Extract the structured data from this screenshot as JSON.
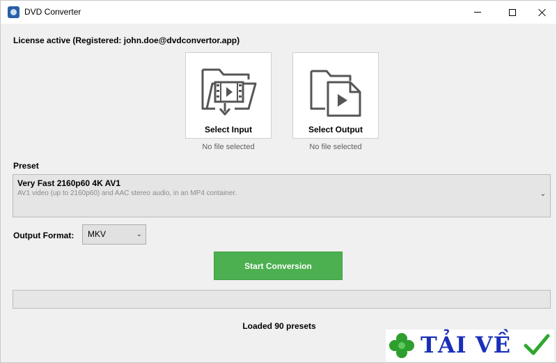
{
  "window": {
    "title": "DVD Converter"
  },
  "license": {
    "text": "License active (Registered: john.doe@dvdconvertor.app)"
  },
  "select_input": {
    "label": "Select Input",
    "status": "No file selected",
    "icon": "folder-video-import-icon"
  },
  "select_output": {
    "label": "Select Output",
    "status": "No file selected",
    "icon": "file-play-icon"
  },
  "preset": {
    "heading": "Preset",
    "name": "Very Fast 2160p60 4K AV1",
    "description": "AV1 video (up to 2160p60) and AAC stereo audio, in an MP4  container.",
    "chevron": "⌄"
  },
  "output_format": {
    "label": "Output Format:",
    "value": "MKV",
    "chevron": "⌄"
  },
  "actions": {
    "start_label": "Start Conversion",
    "start_color": "#4caf50"
  },
  "progress": {
    "value": 0
  },
  "status": {
    "text": "Loaded 90 presets"
  },
  "watermark": {
    "text": "TẢI VỀ",
    "color": "#1a2fb8",
    "icons": [
      "clover-icon",
      "check-icon"
    ]
  }
}
